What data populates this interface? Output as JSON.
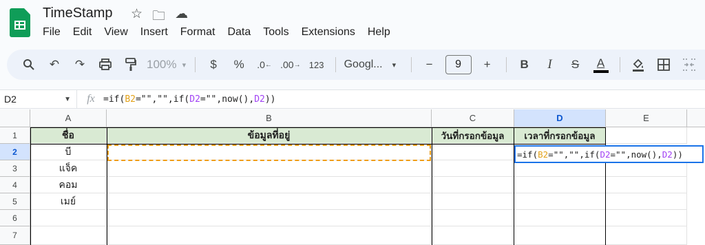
{
  "app": {
    "title": "TimeStamp",
    "menu": [
      "File",
      "Edit",
      "View",
      "Insert",
      "Format",
      "Data",
      "Tools",
      "Extensions",
      "Help"
    ]
  },
  "toolbar": {
    "zoom": "100%",
    "currency": "$",
    "percent": "%",
    "dec_decrease": ".0",
    "dec_increase": ".00",
    "number_format": "123",
    "font": "Googl...",
    "font_size": "9",
    "minus": "−",
    "plus": "+",
    "bold": "B",
    "italic": "I",
    "strike": "S",
    "text_color": "A"
  },
  "formula_bar": {
    "name_box": "D2",
    "fx": "fx",
    "formula_parts": [
      "=if(",
      "B2",
      "=\"\",\"\",if(",
      "D2",
      "=\"\",now(),",
      "D2",
      "))"
    ]
  },
  "sheet": {
    "columns": [
      "A",
      "B",
      "C",
      "D",
      "E"
    ],
    "rows": [
      "1",
      "2",
      "3",
      "4",
      "5",
      "6",
      "7"
    ],
    "headers": {
      "A": "ชื่อ",
      "B": "ข้อมูลที่อยู่",
      "C": "วันที่กรอกข้อมูล",
      "D": "เวลาที่กรอกข้อมูล"
    },
    "names": [
      "บี",
      "แจ็ค",
      "คอม",
      "เมย์"
    ],
    "active_cell": "D2",
    "header_fill": "#d9ead3"
  }
}
